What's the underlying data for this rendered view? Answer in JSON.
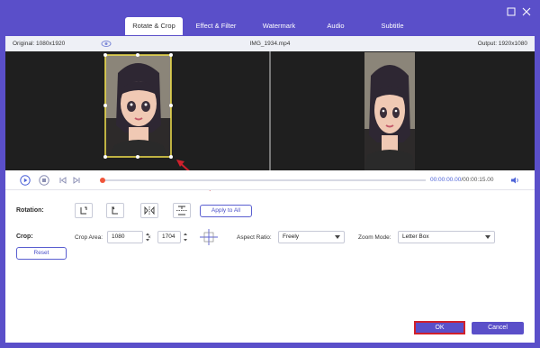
{
  "window": {
    "tabs": [
      {
        "label": "Rotate & Crop",
        "active": true
      },
      {
        "label": "Effect & Filter",
        "active": false
      },
      {
        "label": "Watermark",
        "active": false
      },
      {
        "label": "Audio",
        "active": false
      },
      {
        "label": "Subtitle",
        "active": false
      }
    ],
    "controls": {
      "minimize_icon": "minimize-icon",
      "maximize_icon": "maximize-icon",
      "close_icon": "close-icon"
    }
  },
  "infobar": {
    "original": "Original: 1080x1920",
    "filename": "IMG_1934.mp4",
    "output": "Output: 1920x1080",
    "eye_icon": "eye-icon"
  },
  "playback": {
    "current_time": "00:00:00.00",
    "total_time": "/00:00:15.00",
    "progress": 0.0,
    "icons": [
      "play-icon",
      "stop-icon",
      "previous-frame-icon",
      "next-frame-icon",
      "volume-icon"
    ]
  },
  "rotation": {
    "label": "Rotation:",
    "buttons": [
      "rotate-left-icon",
      "rotate-right-icon",
      "flip-horizontal-icon",
      "flip-vertical-icon"
    ],
    "apply_all": "Apply to All"
  },
  "crop": {
    "label": "Crop:",
    "area_label": "Crop Area:",
    "width": "1080",
    "times": "×",
    "height": "1704",
    "aspect_label": "Aspect Ratio:",
    "aspect_value": "Freely",
    "zoom_label": "Zoom Mode:",
    "zoom_value": "Letter Box",
    "reset": "Reset",
    "center_icon": "crosshair-center-icon"
  },
  "footer": {
    "ok": "OK",
    "cancel": "Cancel"
  },
  "colors": {
    "accent": "#5a4fc9",
    "highlight_border": "#d0202c",
    "crop_box": "#f2e14c",
    "time_accent": "#4d63d8",
    "progress_knob": "#f0553a"
  }
}
